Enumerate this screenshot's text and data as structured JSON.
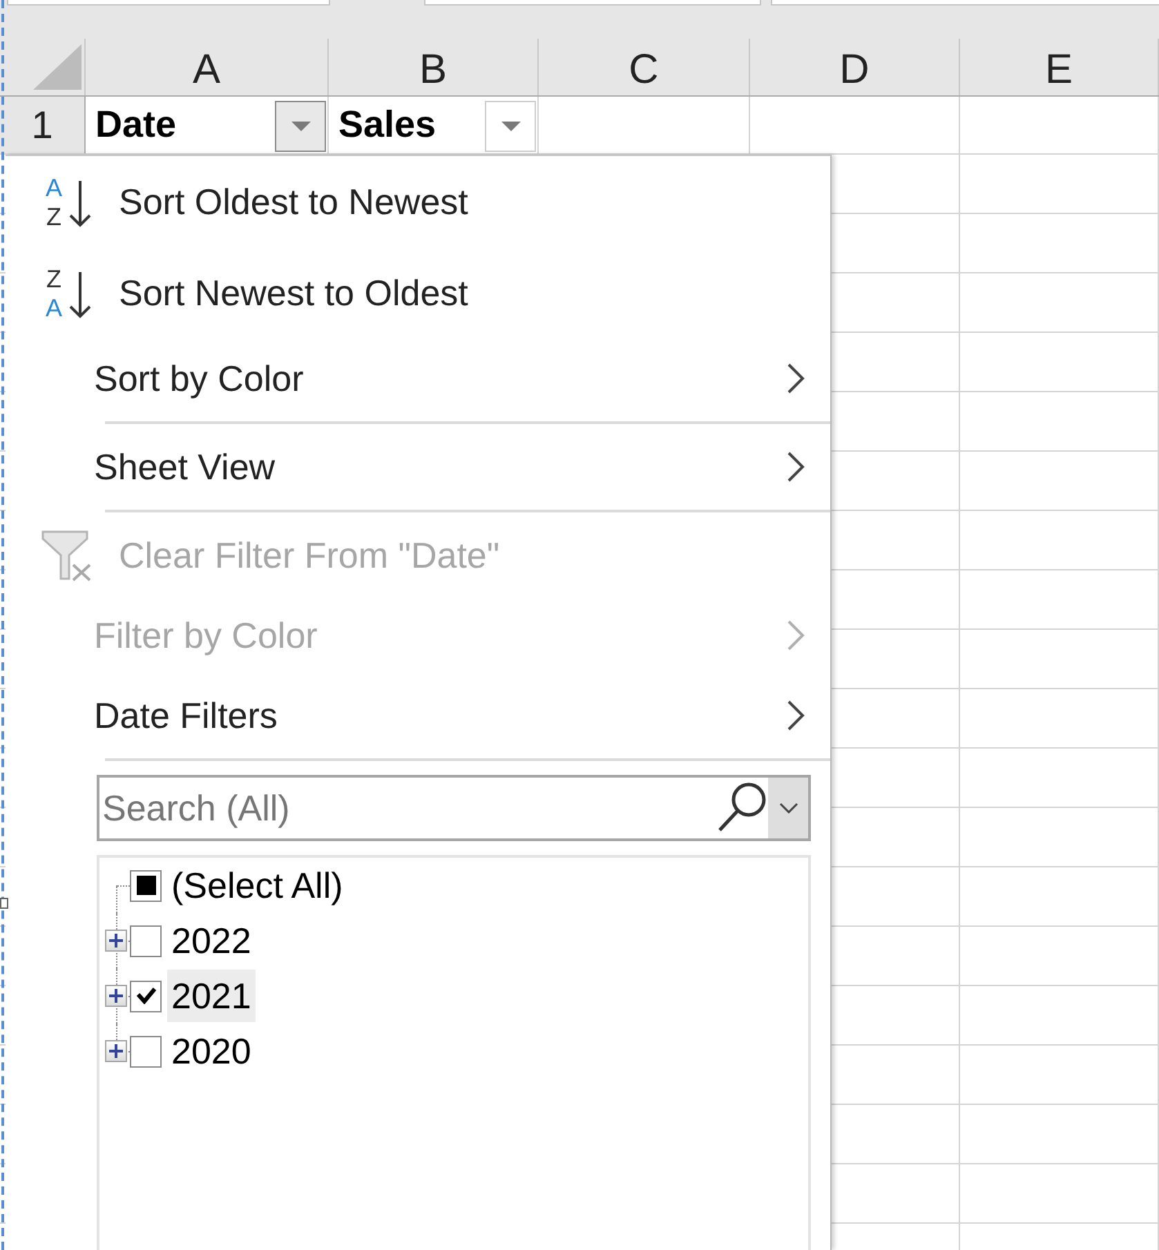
{
  "column_headers": [
    "A",
    "B",
    "C",
    "D",
    "E"
  ],
  "rows": [
    {
      "header": "1",
      "cells": [
        {
          "text": "Date",
          "filter_open": true
        },
        {
          "text": "Sales",
          "filter_open": false
        }
      ]
    }
  ],
  "filter_menu": {
    "items": [
      {
        "kind": "sort_ascending",
        "label": "Sort Oldest to Newest",
        "icon_text": [
          "A",
          "Z"
        ],
        "disabled": false
      },
      {
        "kind": "sort_descending",
        "label": "Sort Newest to Oldest",
        "icon_text": [
          "Z",
          "A"
        ],
        "disabled": false
      },
      {
        "kind": "submenu",
        "label": "Sort by Color",
        "disabled": false
      },
      {
        "kind": "separator"
      },
      {
        "kind": "submenu",
        "label": "Sheet View",
        "disabled": false
      },
      {
        "kind": "separator"
      },
      {
        "kind": "clear_filter",
        "label": "Clear Filter From \"Date\"",
        "disabled": true
      },
      {
        "kind": "submenu",
        "label": "Filter by Color",
        "disabled": true
      },
      {
        "kind": "submenu",
        "label": "Date Filters",
        "disabled": false
      },
      {
        "kind": "separator"
      }
    ],
    "search": {
      "placeholder": "Search (All)"
    },
    "list": [
      {
        "kind": "all",
        "label": "(Select All)",
        "indeterminate": true,
        "selected": false
      },
      {
        "kind": "group",
        "label": "2022",
        "checked": false,
        "expanded": false,
        "selected": false
      },
      {
        "kind": "group",
        "label": "2021",
        "checked": true,
        "expanded": false,
        "selected": true
      },
      {
        "kind": "group",
        "label": "2020",
        "checked": false,
        "expanded": false,
        "selected": false
      }
    ]
  }
}
